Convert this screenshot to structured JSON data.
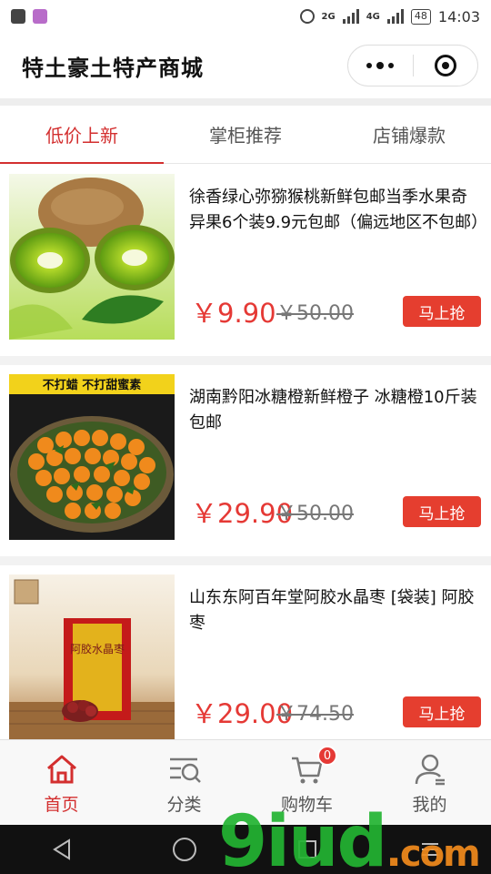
{
  "status_bar": {
    "network_1": "2G",
    "network_2": "4G",
    "battery": "48",
    "time": "14:03"
  },
  "header": {
    "title": "特土豪土特产商城"
  },
  "tabs": [
    {
      "label": "低价上新",
      "active": true
    },
    {
      "label": "掌柜推荐",
      "active": false
    },
    {
      "label": "店铺爆款",
      "active": false
    }
  ],
  "products": [
    {
      "name": "徐香绿心弥猕猴桃新鲜包邮当季水果奇异果6个装9.9元包邮（偏远地区不包邮）",
      "price": "￥9.90",
      "original_price": "￥50.00",
      "buy_label": "马上抢",
      "image_caption": ""
    },
    {
      "name": "湖南黔阳冰糖橙新鲜橙子 冰糖橙10斤装包邮",
      "price": "￥29.90",
      "original_price": "￥50.00",
      "buy_label": "马上抢",
      "image_caption": "不打蜡 不打甜蜜素"
    },
    {
      "name": "山东东阿百年堂阿胶水晶枣 [袋装] 阿胶枣",
      "price": "￥29.00",
      "original_price": "￥74.50",
      "buy_label": "马上抢",
      "image_caption": "阿胶水晶枣"
    }
  ],
  "tabbar": [
    {
      "label": "首页",
      "icon": "home-icon",
      "active": true
    },
    {
      "label": "分类",
      "icon": "category-search-icon",
      "active": false
    },
    {
      "label": "购物车",
      "icon": "cart-icon",
      "active": false,
      "badge": "0"
    },
    {
      "label": "我的",
      "icon": "user-icon",
      "active": false
    }
  ],
  "watermark": {
    "main": "9iud",
    "dot": ".",
    "suffix": "com"
  },
  "colors": {
    "accent": "#e53935",
    "tab_active": "#d32f2f",
    "buy_button": "#e53e2f"
  }
}
